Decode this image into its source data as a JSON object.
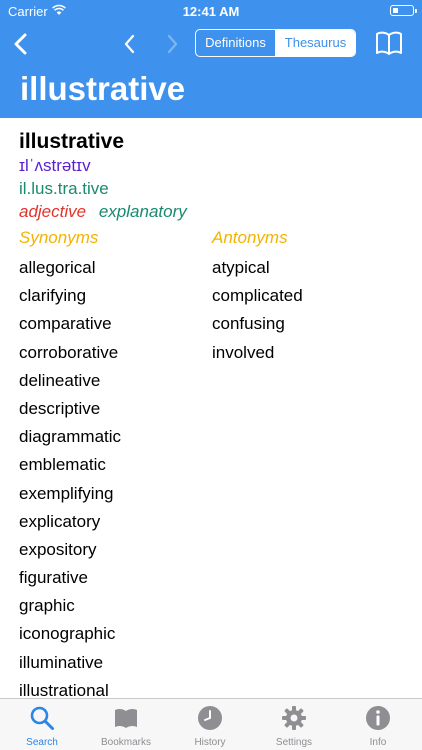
{
  "status": {
    "carrier": "Carrier",
    "time": "12:41 AM"
  },
  "nav": {
    "segments": [
      {
        "label": "Definitions",
        "active": false
      },
      {
        "label": "Thesaurus",
        "active": true
      }
    ]
  },
  "title": "illustrative",
  "entry": {
    "headword": "illustrative",
    "ipa": "ɪlˈʌstrətɪv",
    "syllables": "il.lus.tra.tive",
    "part_of_speech": "adjective",
    "sense": "explanatory"
  },
  "synonyms": {
    "heading": "Synonyms",
    "items": [
      "allegorical",
      "clarifying",
      "comparative",
      "corroborative",
      "delineative",
      "descriptive",
      "diagrammatic",
      "emblematic",
      "exemplifying",
      "explicatory",
      "expository",
      "figurative",
      "graphic",
      "iconographic",
      "illuminative",
      "illustrational"
    ]
  },
  "antonyms": {
    "heading": "Antonyms",
    "items": [
      "atypical",
      "complicated",
      "confusing",
      "involved"
    ]
  },
  "tabs": [
    {
      "label": "Search",
      "icon": "search-icon",
      "active": true
    },
    {
      "label": "Bookmarks",
      "icon": "bookmarks-icon",
      "active": false
    },
    {
      "label": "History",
      "icon": "history-icon",
      "active": false
    },
    {
      "label": "Settings",
      "icon": "gear-icon",
      "active": false
    },
    {
      "label": "Info",
      "icon": "info-icon",
      "active": false
    }
  ],
  "colors": {
    "header": "#3e91ec",
    "ipa": "#5a1fd1",
    "syllables": "#1a8a6e",
    "pos": "#e0342c",
    "column_heading": "#f3b300",
    "active_tab": "#2c86e8"
  }
}
